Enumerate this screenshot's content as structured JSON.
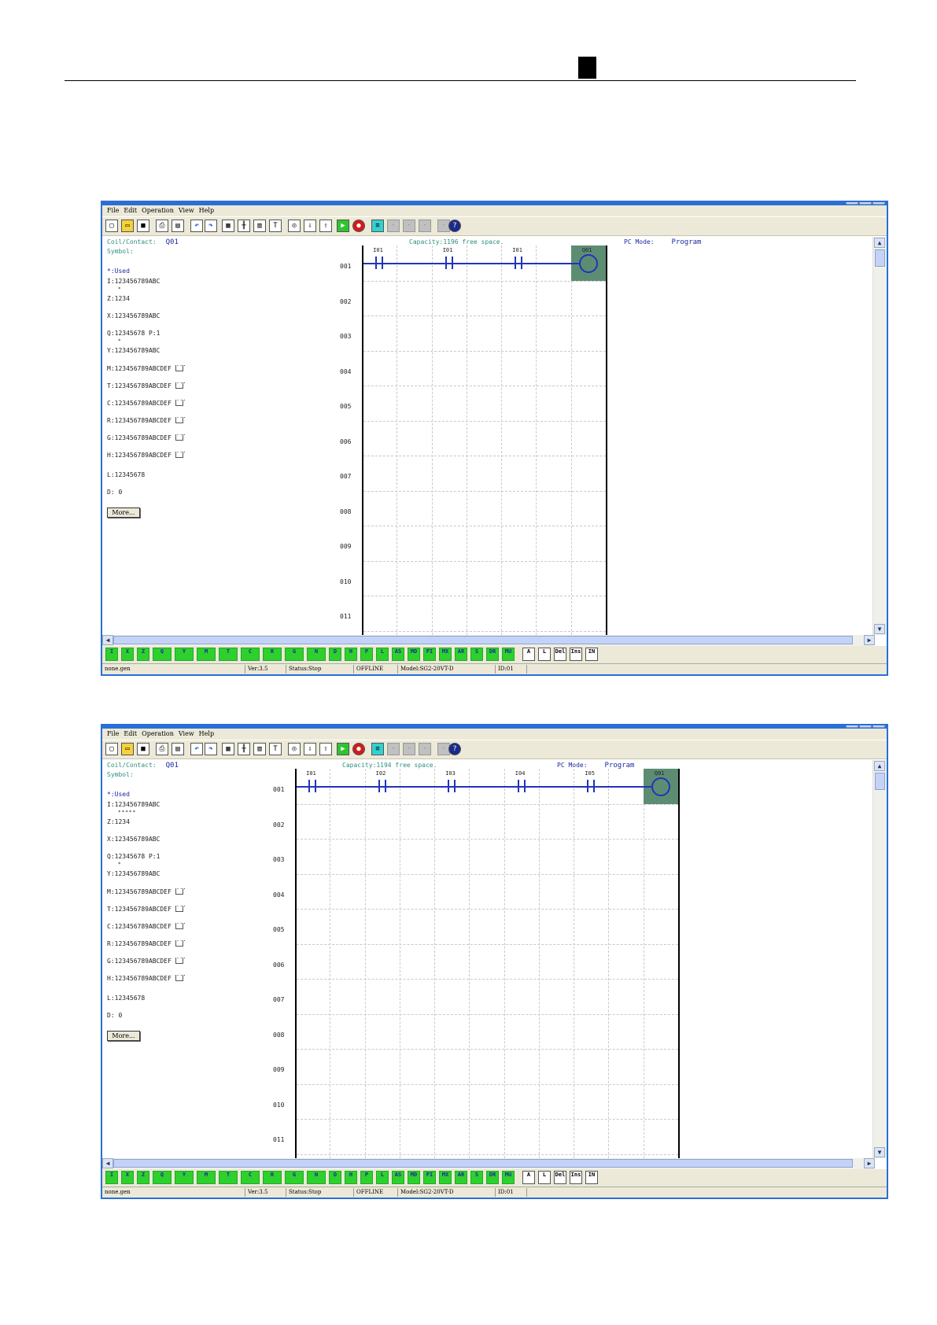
{
  "menu": [
    "File",
    "Edit",
    "Operation",
    "View",
    "Help"
  ],
  "toolbar_icons": [
    "new-icon",
    "open-icon",
    "save-icon",
    "print-icon",
    "preview-icon",
    "undo-icon",
    "redo-icon",
    "monitor-icon",
    "ladder-icon",
    "fbd-icon",
    "text-icon",
    "stop-icon",
    "read-icon",
    "write-icon",
    "run-icon",
    "halt-icon",
    "compare-icon",
    "disabled-icon",
    "disabled-icon",
    "disabled-icon",
    "disabled-icon",
    "help-icon"
  ],
  "sidebar": {
    "coil_label": "Coil/Contact:",
    "coil_value": "Q01",
    "symbol_label": "Symbol:",
    "used_label": "*:Used",
    "vars": {
      "I": "I:123456789ABC",
      "Z": "Z:1234",
      "X": "X:123456789ABC",
      "Q": "Q:12345678  P:1",
      "Y": "Y:123456789ABC",
      "M": "M:123456789ABCDEF",
      "T": "T:123456789ABCDEF",
      "C": "C:123456789ABCDEF",
      "R": "R:123456789ABCDEF",
      "G": "G:123456789ABCDEF",
      "H": "H:123456789ABCDEF",
      "L": "L:12345678",
      "D": "D:  0"
    },
    "more_button": "More..."
  },
  "pc_mode_label": "PC Mode:",
  "pc_mode_value": "Program",
  "rung_numbers": [
    "001",
    "002",
    "003",
    "004",
    "005",
    "006",
    "007",
    "008",
    "009",
    "010",
    "011"
  ],
  "windows": [
    {
      "capacity": "Capacity:1196 free space.",
      "i_marks": "*",
      "q_marks": "*",
      "contacts": [
        "I01",
        "I01",
        "I01"
      ],
      "coil": "Q01"
    },
    {
      "capacity": "Capacity:1194 free space.",
      "i_marks": "*****",
      "q_marks": "*",
      "contacts": [
        "I01",
        "I02",
        "I03",
        "I04",
        "I05"
      ],
      "coil": "Q01"
    }
  ],
  "instruction_bar": [
    {
      "name": "i-contact-button",
      "label": "I"
    },
    {
      "name": "x-contact-button",
      "label": "X"
    },
    {
      "name": "z-contact-button",
      "label": "Z"
    },
    {
      "name": "q-coil-button",
      "label": "Q"
    },
    {
      "name": "y-coil-button",
      "label": "Y"
    },
    {
      "name": "m-coil-button",
      "label": "M"
    },
    {
      "name": "t-coil-button",
      "label": "T"
    },
    {
      "name": "c-coil-button",
      "label": "C"
    },
    {
      "name": "r-coil-button",
      "label": "R"
    },
    {
      "name": "g-coil-button",
      "label": "G"
    },
    {
      "name": "n-coil-button",
      "label": "N"
    },
    {
      "name": "d-coil-button",
      "label": "D"
    },
    {
      "name": "h-coil-button",
      "label": "H"
    },
    {
      "name": "p-coil-button",
      "label": "P"
    },
    {
      "name": "l-coil-button",
      "label": "L"
    },
    {
      "name": "as-coil-button",
      "label": "AS"
    },
    {
      "name": "md-coil-button",
      "label": "MD"
    },
    {
      "name": "pi-coil-button",
      "label": "PI"
    },
    {
      "name": "mx-coil-button",
      "label": "MX"
    },
    {
      "name": "ar-coil-button",
      "label": "AR"
    },
    {
      "name": "s-coil-button",
      "label": "S"
    },
    {
      "name": "dr-coil-button",
      "label": "DR"
    },
    {
      "name": "mu-coil-button",
      "label": "MU"
    },
    {
      "name": "horizontal-line-button",
      "label": "A"
    },
    {
      "name": "vertical-line-button",
      "label": "L"
    },
    {
      "name": "delete-button",
      "label": "Del"
    },
    {
      "name": "insert-button",
      "label": "Ins"
    },
    {
      "name": "insert-line-button",
      "label": "IN"
    }
  ],
  "status": {
    "file": "none.gen",
    "version": "Ver:3.5",
    "state": "Status:Stop",
    "connection": "OFFLINE",
    "model": "Model:SG2-20VT-D",
    "id": "ID:01"
  },
  "colors": {
    "window_border": "#2a6fd6",
    "wire": "#2233bb",
    "coil_cell": "#5c8d73",
    "info_teal": "#2f8f7f",
    "info_blue": "#1a2aa0",
    "button_green": "#2ed02e"
  }
}
